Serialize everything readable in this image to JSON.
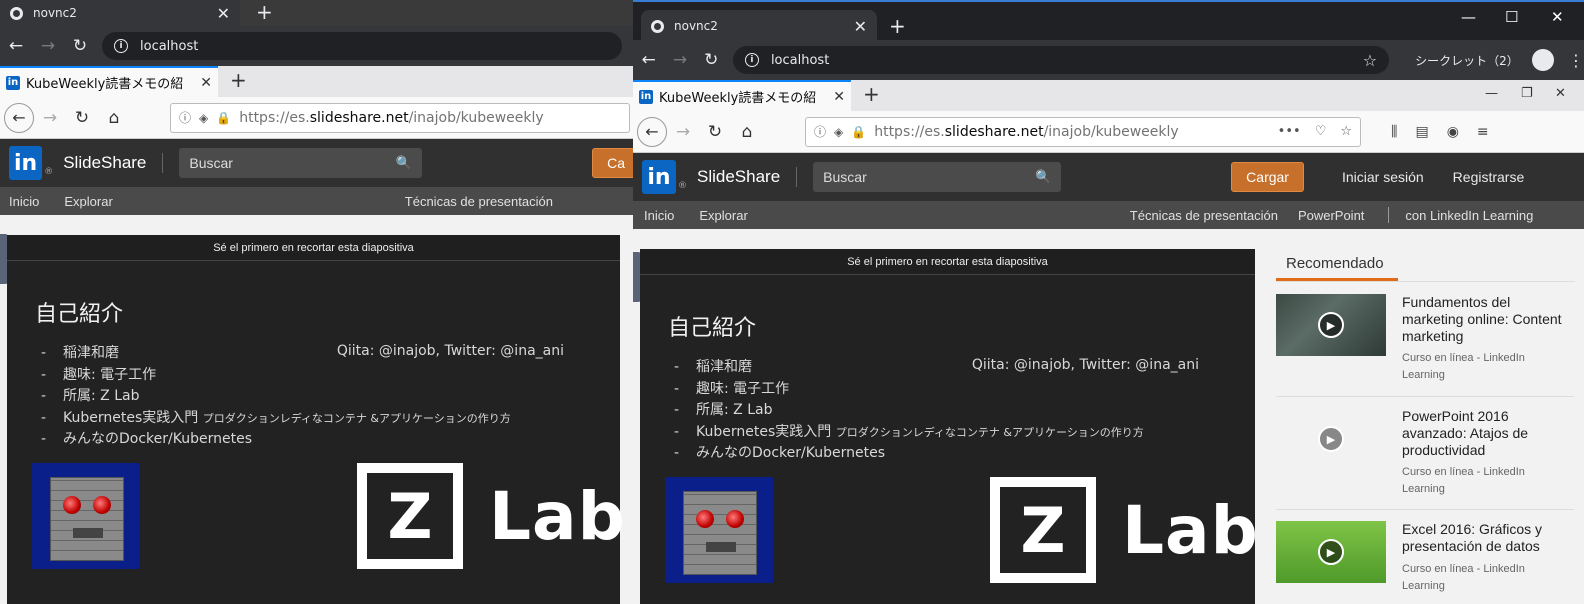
{
  "browser": {
    "tab_title": "novnc2",
    "address": "localhost",
    "incognito_label": "シークレット（2）"
  },
  "firefox": {
    "tab_title": "KubeWeekly読書メモの紹",
    "url_prefix": "https://es.",
    "url_host": "slideshare.net",
    "url_path": "/inajob/kubeweekly",
    "url_more": "•••"
  },
  "header": {
    "logo_text": "in",
    "brand": "SlideShare",
    "search_placeholder": "Buscar",
    "upload_label": "Cargar",
    "upload_label_clipped": "Ca",
    "login_label": "Iniciar sesión",
    "register_label": "Registrarse"
  },
  "subnav": {
    "home": "Inicio",
    "explore": "Explorar",
    "techniques": "Técnicas de presentación",
    "powerpoint": "PowerPoint",
    "linkedin": "con LinkedIn Learning"
  },
  "player": {
    "clip_text": "Sé el primero en recortar esta diapositiva"
  },
  "slide": {
    "title": "自己紹介",
    "items": [
      "稲津和磨",
      "趣味: 電子工作",
      "所属: Z Lab",
      "Kubernetes実践入門",
      "みんなのDocker/Kubernetes"
    ],
    "book_subtitle": "プロダクションレディなコンテナ &アプリケーションの作り方",
    "social": "Qiita: @inajob, Twitter: @ina_ani",
    "logo_letter": "Z",
    "logo_word": "Lab"
  },
  "recommended": {
    "heading": "Recomendado",
    "items": [
      {
        "title": "Fundamentos del marketing online: Content marketing",
        "source": "Curso en línea - LinkedIn Learning"
      },
      {
        "title": "PowerPoint 2016 avanzado: Atajos de productividad",
        "source": "Curso en línea - LinkedIn Learning"
      },
      {
        "title": "Excel 2016: Gráficos y presentación de datos",
        "source": "Curso en línea - LinkedIn Learning"
      }
    ]
  },
  "colors": {
    "upload": "#c7702b",
    "linkedin": "#0a66c2",
    "accent_tab": "#e06b18"
  }
}
